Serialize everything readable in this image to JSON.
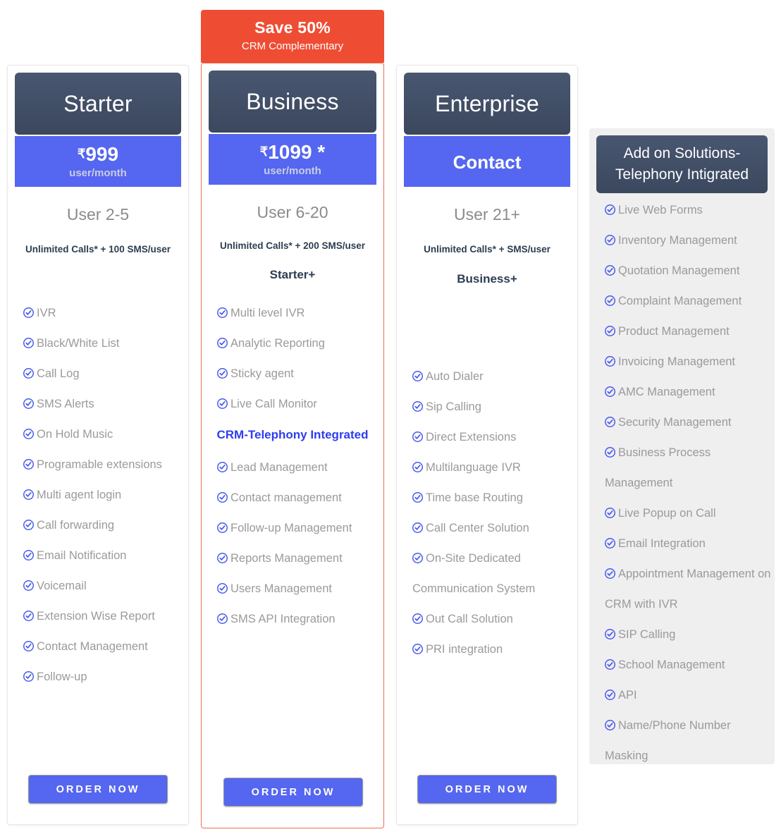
{
  "plans": [
    {
      "id": "starter",
      "badge": null,
      "name": "Starter",
      "price_rupee": "₹",
      "price_amount": "999",
      "price_period": "user/month",
      "users": "User 2-5",
      "calls": "Unlimited Calls* + 100 SMS/user",
      "plus_label": "",
      "crm_label": "",
      "features": [
        "IVR",
        "Black/White List",
        "Call Log",
        "SMS Alerts",
        "On Hold Music",
        "Programable extensions",
        "Multi agent login",
        "Call forwarding",
        "Email Notification",
        "Voicemail",
        "Extension Wise Report",
        "Contact Management",
        "Follow-up"
      ],
      "crm_features": [],
      "order_label": "ORDER NOW"
    },
    {
      "id": "business",
      "badge": {
        "main": "Save 50%",
        "sub": "CRM Complementary"
      },
      "name": "Business",
      "price_rupee": "₹",
      "price_amount": "1099 *",
      "price_period": "user/month",
      "users": "User 6-20",
      "calls": "Unlimited Calls* + 200 SMS/user",
      "plus_label": "Starter+",
      "crm_label": "CRM-Telephony Integrated",
      "features": [
        "Multi level IVR",
        "Analytic Reporting",
        "Sticky agent",
        "Live Call Monitor"
      ],
      "crm_features": [
        "Lead Management",
        "Contact management",
        "Follow-up Management",
        "Reports Management",
        "Users Management",
        "SMS API Integration"
      ],
      "order_label": "ORDER NOW"
    },
    {
      "id": "enterprise",
      "badge": null,
      "name": "Enterprise",
      "price_rupee": "",
      "price_amount": "Contact",
      "price_period": "",
      "users": "User 21+",
      "calls": "Unlimited Calls* + SMS/user",
      "plus_label": "Business+",
      "crm_label": "",
      "features": [
        "Auto Dialer",
        "Sip Calling",
        "Direct Extensions",
        "Multilanguage IVR",
        "Time base Routing",
        "Call Center Solution",
        "On-Site Dedicated Communication System",
        "Out Call Solution",
        "PRI integration"
      ],
      "crm_features": [],
      "order_label": "ORDER NOW"
    }
  ],
  "addon": {
    "title": "Add on Solutions-Telephony Intigrated",
    "items": [
      "Live Web Forms",
      "Inventory Management",
      "Quotation Management",
      "Complaint Management",
      "Product Management",
      "Invoicing Management",
      "AMC Management",
      "Security Management",
      "Business Process Management",
      "Live Popup on Call",
      "Email Integration",
      "Appointment Management on CRM with IVR",
      "SIP Calling",
      "School Management",
      "API",
      "Name/Phone Number Masking"
    ]
  },
  "colors": {
    "accent_blue": "#5566f0",
    "header_dark": "#3b485e",
    "badge_red": "#ee4d33",
    "featured_border": "#ef6c51",
    "addon_bg": "#efefef",
    "feature_text": "#9a9a9a",
    "tick": "#4a5cf0"
  }
}
